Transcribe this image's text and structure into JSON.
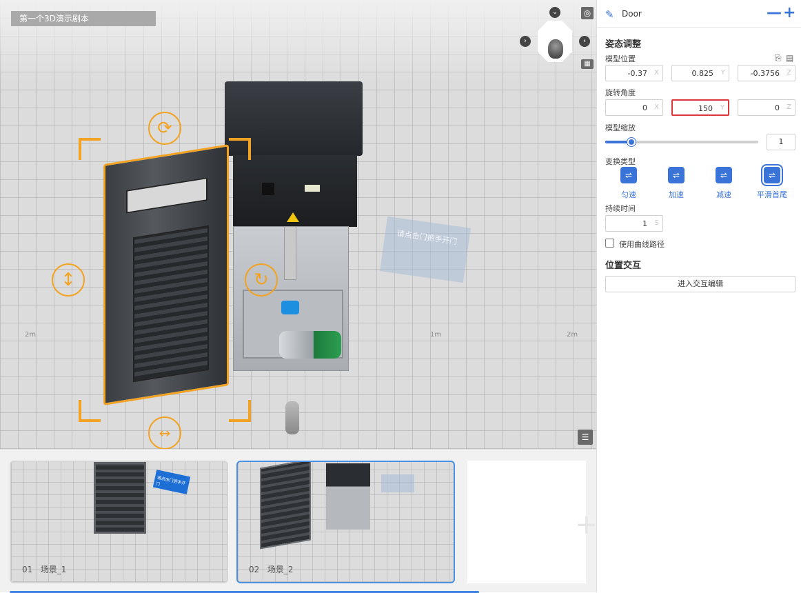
{
  "viewport": {
    "scene_title": "第一个3D演示剧本",
    "axis_ticks": [
      "2m",
      "1m",
      "2m"
    ],
    "hint_card_text": "请点击门把手开门"
  },
  "scenes": [
    {
      "index": "01",
      "name": "场景_1",
      "active": false,
      "thumb_text": "请点击门把手开门"
    },
    {
      "index": "02",
      "name": "场景_2",
      "active": true
    }
  ],
  "panel": {
    "object_name": "Door",
    "zoom_out": "—",
    "zoom_in": "+",
    "pose_title": "姿态调整",
    "position": {
      "label": "模型位置",
      "x": "-0.37",
      "y": "0.825",
      "z": "-0.3756"
    },
    "rotation": {
      "label": "旋转角度",
      "x": "0",
      "y": "150",
      "z": "0"
    },
    "scale": {
      "label": "模型缩放",
      "value": "1",
      "slider_fraction": 0.17
    },
    "axes": {
      "x": "X",
      "y": "Y",
      "z": "Z"
    },
    "transform_type": {
      "label": "变换类型",
      "options": [
        "匀速",
        "加速",
        "减速",
        "平滑首尾"
      ],
      "selected": "平滑首尾"
    },
    "duration": {
      "label": "持续时间",
      "value": "1",
      "unit": "S"
    },
    "curve_path": {
      "label": "使用曲线路径",
      "checked": false
    },
    "interaction": {
      "title": "位置交互",
      "button": "进入交互编辑"
    }
  }
}
